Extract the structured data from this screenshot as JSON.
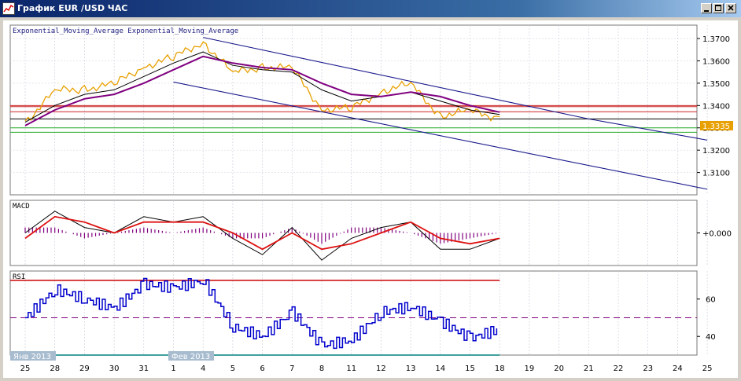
{
  "window": {
    "title": "График EUR /USD  ЧАС",
    "buttons": [
      "minimize",
      "maximize",
      "close"
    ]
  },
  "colors": {
    "price": "#e8a000",
    "ema_fast": "#000000",
    "ema_slow": "#800080",
    "channel": "#1a1a8c",
    "resistance": "#cc2222",
    "support": "#22aa22",
    "macd_line": "#000000",
    "signal_line": "#dd1111",
    "histogram": "#800080",
    "rsi": "#0000cc",
    "rsi_upper": "#cc0000",
    "rsi_lower": "#008080",
    "rsi_mid": "#800080",
    "price_badge": "#e8a000"
  },
  "main_panel": {
    "legend": "Exponential_Moving_Average Exponential_Moving_Average",
    "y_ticks": [
      "1.3700",
      "1.3600",
      "1.3500",
      "1.3400",
      "1.3300",
      "1.3200",
      "1.3100"
    ],
    "current_price": "1.3335"
  },
  "macd_panel": {
    "label": "MACD",
    "y_ticks": [
      "+0.000"
    ]
  },
  "rsi_panel": {
    "label": "RSI",
    "y_ticks": [
      "60",
      "40"
    ]
  },
  "x_axis": {
    "ticks": [
      "25",
      "28",
      "29",
      "30",
      "31",
      "1",
      "4",
      "5",
      "6",
      "7",
      "8",
      "11",
      "12",
      "13",
      "14",
      "15",
      "18",
      "19",
      "20",
      "21",
      "22",
      "23",
      "24",
      "25"
    ],
    "month_labels": [
      "Янв 2013",
      "Фев 2013"
    ]
  },
  "chart_data": [
    {
      "type": "line",
      "title": "",
      "ylim": [
        1.3,
        1.376
      ],
      "x": [
        "Jan 25",
        "Jan 28",
        "Jan 29",
        "Jan 30",
        "Jan 31",
        "Feb 1",
        "Feb 4",
        "Feb 5",
        "Feb 6",
        "Feb 7",
        "Feb 8",
        "Feb 11",
        "Feb 12",
        "Feb 13",
        "Feb 14",
        "Feb 15",
        "Feb 18"
      ],
      "series": [
        {
          "values": [
            1.333,
            1.346,
            1.348,
            1.349,
            1.358,
            1.361,
            1.369,
            1.354,
            1.358,
            1.356,
            1.339,
            1.338,
            1.347,
            1.349,
            1.336,
            1.337,
            1.335
          ]
        },
        {
          "values": [
            1.3325,
            1.34,
            1.345,
            1.347,
            1.353,
            1.359,
            1.364,
            1.358,
            1.356,
            1.355,
            1.347,
            1.342,
            1.344,
            1.346,
            1.342,
            1.338,
            1.336
          ]
        },
        {
          "values": [
            1.331,
            1.338,
            1.343,
            1.345,
            1.35,
            1.356,
            1.362,
            1.359,
            1.357,
            1.356,
            1.35,
            1.345,
            1.344,
            1.346,
            1.344,
            1.34,
            1.337
          ]
        }
      ],
      "horizontal_lines": [
        1.34,
        1.3395,
        1.3372,
        1.334,
        1.33,
        1.328
      ],
      "channel": {
        "upper": [
          {
            "x": "Feb 4",
            "y": 1.3705
          },
          {
            "x": "Feb 21",
            "y": 1.334
          }
        ],
        "upper_ext": [
          {
            "x": "Feb 21",
            "y": 1.334
          },
          {
            "x": "Feb 25",
            "y": 1.3245
          }
        ],
        "lower": [
          {
            "x": "Feb 1",
            "y": 1.3505
          },
          {
            "x": "Feb 25",
            "y": 1.3025
          }
        ]
      }
    },
    {
      "type": "line",
      "title": "",
      "ylim": [
        -0.006,
        0.006
      ],
      "x": [
        "Jan 25",
        "Jan 28",
        "Jan 29",
        "Jan 30",
        "Jan 31",
        "Feb 1",
        "Feb 4",
        "Feb 5",
        "Feb 6",
        "Feb 7",
        "Feb 8",
        "Feb 11",
        "Feb 12",
        "Feb 13",
        "Feb 14",
        "Feb 15",
        "Feb 18"
      ],
      "series": [
        {
          "values": [
            0.0,
            0.004,
            0.001,
            0.0,
            0.003,
            0.002,
            0.003,
            -0.001,
            -0.004,
            0.001,
            -0.005,
            -0.001,
            0.001,
            0.002,
            -0.003,
            -0.003,
            -0.001
          ]
        },
        {
          "values": [
            -0.001,
            0.003,
            0.002,
            0.0,
            0.002,
            0.002,
            0.002,
            0.0,
            -0.003,
            0.0,
            -0.003,
            -0.002,
            0.0,
            0.002,
            -0.001,
            -0.002,
            -0.001
          ]
        },
        {
          "values": [
            0.001,
            0.001,
            -0.001,
            0.0,
            0.001,
            0.0,
            0.001,
            -0.001,
            -0.001,
            0.001,
            -0.002,
            0.001,
            0.001,
            0.0,
            -0.002,
            -0.001,
            0.0
          ]
        }
      ]
    },
    {
      "type": "line",
      "title": "",
      "ylim": [
        30,
        75
      ],
      "x": [
        "Jan 25",
        "Jan 28",
        "Jan 29",
        "Jan 30",
        "Jan 31",
        "Feb 1",
        "Feb 4",
        "Feb 5",
        "Feb 6",
        "Feb 7",
        "Feb 8",
        "Feb 11",
        "Feb 12",
        "Feb 13",
        "Feb 14",
        "Feb 15",
        "Feb 18"
      ],
      "series": [
        {
          "values": [
            50,
            65,
            60,
            55,
            68,
            66,
            70,
            45,
            40,
            53,
            35,
            38,
            53,
            56,
            48,
            39,
            44
          ]
        }
      ],
      "levels": {
        "upper": 70,
        "mid": 50,
        "lower": 30
      }
    }
  ]
}
